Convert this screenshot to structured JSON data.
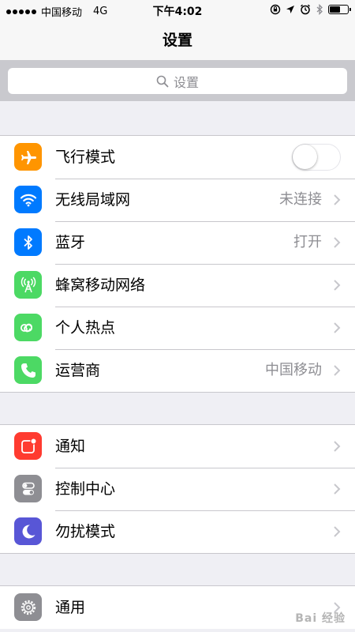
{
  "status_bar": {
    "carrier": "中国移动",
    "network": "4G",
    "time": "下午4:02"
  },
  "nav": {
    "title": "设置"
  },
  "search": {
    "placeholder": "设置"
  },
  "group1": {
    "items": [
      {
        "label": "飞行模式",
        "icon": "airplane-icon",
        "icon_color": "#ff9500",
        "toggle": true,
        "toggle_on": false
      },
      {
        "label": "无线局域网",
        "value": "未连接",
        "icon": "wifi-icon",
        "icon_color": "#007aff"
      },
      {
        "label": "蓝牙",
        "value": "打开",
        "icon": "bluetooth-icon",
        "icon_color": "#007aff"
      },
      {
        "label": "蜂窝移动网络",
        "value": "",
        "icon": "cellular-icon",
        "icon_color": "#4cd964"
      },
      {
        "label": "个人热点",
        "value": "",
        "icon": "hotspot-icon",
        "icon_color": "#4cd964"
      },
      {
        "label": "运营商",
        "value": "中国移动",
        "icon": "phone-icon",
        "icon_color": "#4cd964"
      }
    ]
  },
  "group2": {
    "items": [
      {
        "label": "通知",
        "icon": "notifications-icon",
        "icon_color": "#ff3b30"
      },
      {
        "label": "控制中心",
        "icon": "control-center-icon",
        "icon_color": "#8e8e93"
      },
      {
        "label": "勿扰模式",
        "icon": "moon-icon",
        "icon_color": "#5856d6"
      }
    ]
  },
  "group3": {
    "items": [
      {
        "label": "通用",
        "icon": "gear-icon",
        "icon_color": "#8e8e93"
      }
    ]
  },
  "watermark": "Bai 经验",
  "battery_level": 0.6
}
